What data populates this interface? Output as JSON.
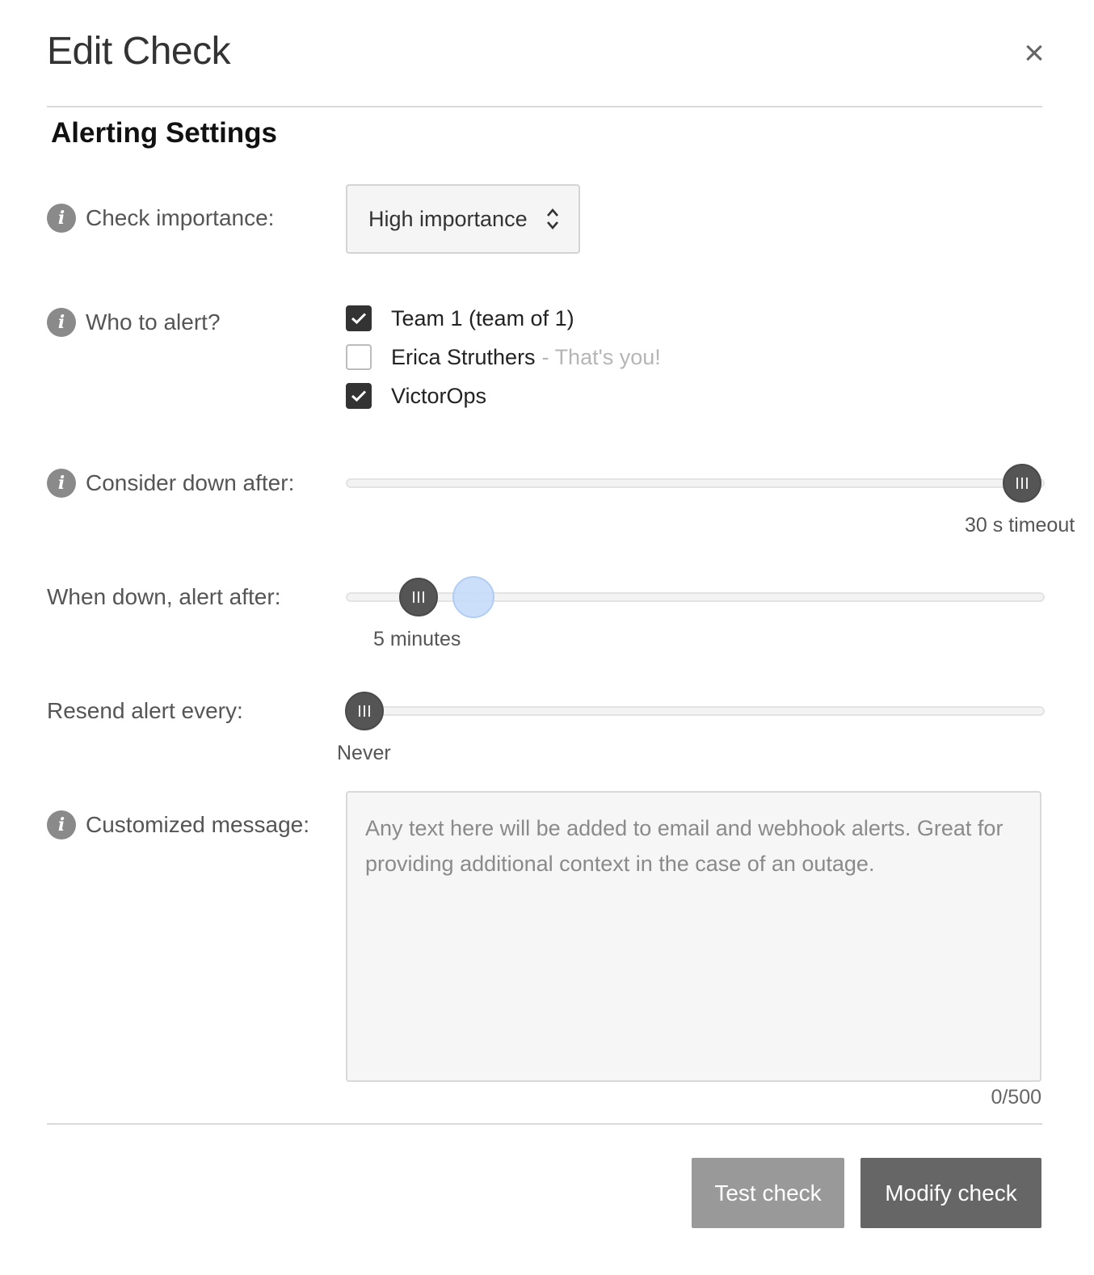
{
  "header": {
    "title": "Edit Check",
    "close_glyph": "×"
  },
  "section": {
    "title": "Alerting Settings"
  },
  "importance": {
    "label": "Check importance:",
    "selected": "High importance"
  },
  "who_to_alert": {
    "label": "Who to alert?",
    "options": [
      {
        "name": "Team 1 (team of 1)",
        "note": "",
        "checked": true
      },
      {
        "name": "Erica Struthers",
        "note": "- That's you!",
        "checked": false
      },
      {
        "name": "VictorOps",
        "note": "",
        "checked": true
      }
    ]
  },
  "consider_down": {
    "label": "Consider down after:",
    "value_text": "30 s timeout",
    "position": 1.0
  },
  "alert_after": {
    "label": "When down, alert after:",
    "value_text": "5 minutes",
    "position": 0.105
  },
  "resend": {
    "label": "Resend alert every:",
    "value_text": "Never",
    "position": 0.0
  },
  "message": {
    "label": "Customized message:",
    "placeholder": "Any text here will be added to email and webhook alerts. Great for providing additional context in the case of an outage.",
    "counter": "0/500"
  },
  "footer": {
    "test_label": "Test check",
    "modify_label": "Modify check"
  },
  "colors": {
    "checkbox_checked": "#333333",
    "slider_handle": "#555555",
    "ghost_handle": "#c7dcfa",
    "button_secondary": "#999999",
    "button_primary": "#666666"
  },
  "icons": [
    "close-icon",
    "info-icon",
    "sort-arrows-icon",
    "checkmark-icon",
    "grip-icon"
  ]
}
